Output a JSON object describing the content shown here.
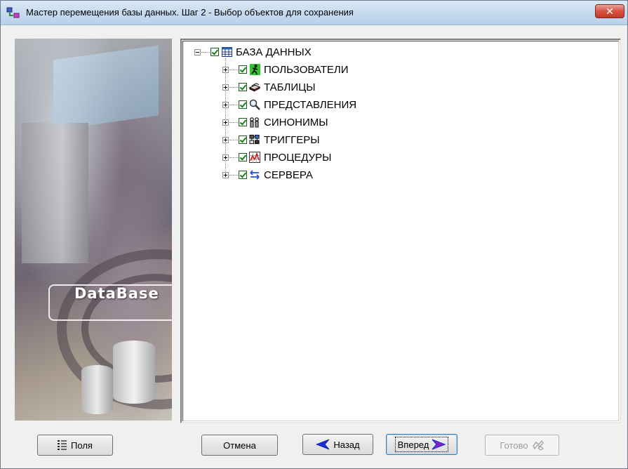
{
  "window": {
    "title": "Мастер перемещения базы данных. Шаг 2 - Выбор объектов для сохранения",
    "close_symbol": "✕"
  },
  "side_image": {
    "label": "DataBase"
  },
  "tree": {
    "root": {
      "label": "БАЗА ДАННЫХ",
      "icon": "table-grid-icon",
      "checked": true,
      "expanded": true
    },
    "children": [
      {
        "label": "ПОЛЬЗОВАТЕЛИ",
        "icon": "running-man-icon",
        "checked": true
      },
      {
        "label": "ТАБЛИЦЫ",
        "icon": "table-stack-icon",
        "checked": true
      },
      {
        "label": "ПРЕДСТАВЛЕНИЯ",
        "icon": "magnifier-icon",
        "checked": true
      },
      {
        "label": "СИНОНИМЫ",
        "icon": "synonyms-icon",
        "checked": true
      },
      {
        "label": "ТРИГГЕРЫ",
        "icon": "triggers-icon",
        "checked": true
      },
      {
        "label": "ПРОЦЕДУРЫ",
        "icon": "procedures-chart-icon",
        "checked": true
      },
      {
        "label": "СЕРВЕРА",
        "icon": "swap-arrows-icon",
        "checked": true
      }
    ]
  },
  "buttons": {
    "fields": "Поля",
    "cancel": "Отмена",
    "back": "Назад",
    "next": "Вперед",
    "finish": "Готово"
  },
  "colors": {
    "title_bar": "#c7dbef",
    "close_button": "#c0392b",
    "check_mark": "#1a7f1a",
    "arrow_back": "#1a2fd6",
    "arrow_next_fill": "#8a1fc4"
  }
}
